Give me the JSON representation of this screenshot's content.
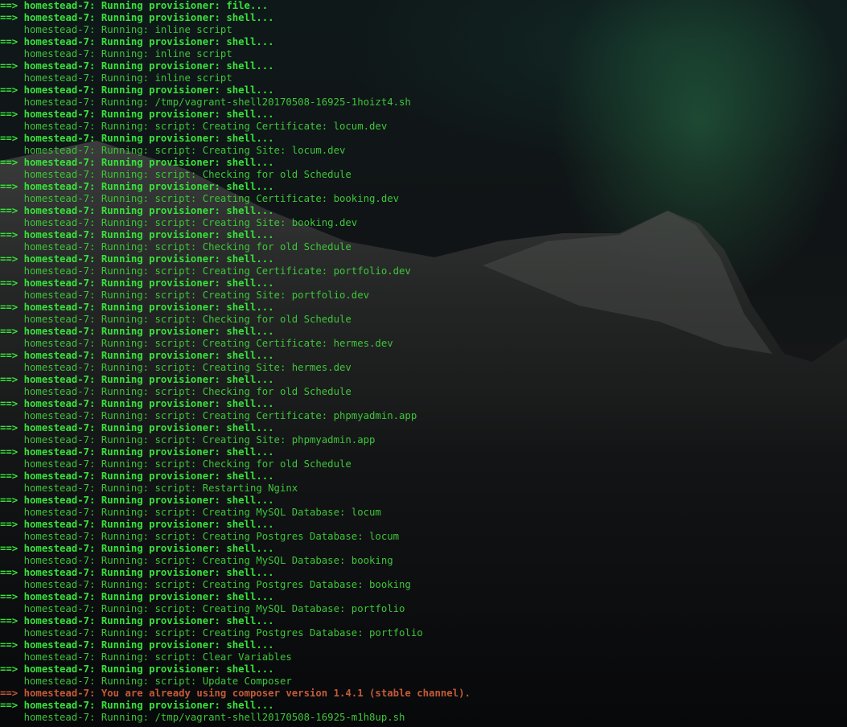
{
  "colors": {
    "header_green": "#38e23a",
    "detail_green": "#3ec63a",
    "warning_red": "#c45a36"
  },
  "terminal": {
    "lines": [
      {
        "kind": "header",
        "arrow": "==>",
        "text": " homestead-7: Running provisioner: file..."
      },
      {
        "kind": "header",
        "arrow": "==>",
        "text": " homestead-7: Running provisioner: shell..."
      },
      {
        "kind": "detail",
        "text": "    homestead-7: Running: inline script"
      },
      {
        "kind": "header",
        "arrow": "==>",
        "text": " homestead-7: Running provisioner: shell..."
      },
      {
        "kind": "detail",
        "text": "    homestead-7: Running: inline script"
      },
      {
        "kind": "header",
        "arrow": "==>",
        "text": " homestead-7: Running provisioner: shell..."
      },
      {
        "kind": "detail",
        "text": "    homestead-7: Running: inline script"
      },
      {
        "kind": "header",
        "arrow": "==>",
        "text": " homestead-7: Running provisioner: shell..."
      },
      {
        "kind": "detail",
        "text": "    homestead-7: Running: /tmp/vagrant-shell20170508-16925-1hoizt4.sh"
      },
      {
        "kind": "header",
        "arrow": "==>",
        "text": " homestead-7: Running provisioner: shell..."
      },
      {
        "kind": "detail",
        "text": "    homestead-7: Running: script: Creating Certificate: locum.dev"
      },
      {
        "kind": "header",
        "arrow": "==>",
        "text": " homestead-7: Running provisioner: shell..."
      },
      {
        "kind": "detail",
        "text": "    homestead-7: Running: script: Creating Site: locum.dev"
      },
      {
        "kind": "header",
        "arrow": "==>",
        "text": " homestead-7: Running provisioner: shell..."
      },
      {
        "kind": "detail",
        "text": "    homestead-7: Running: script: Checking for old Schedule"
      },
      {
        "kind": "header",
        "arrow": "==>",
        "text": " homestead-7: Running provisioner: shell..."
      },
      {
        "kind": "detail",
        "text": "    homestead-7: Running: script: Creating Certificate: booking.dev"
      },
      {
        "kind": "header",
        "arrow": "==>",
        "text": " homestead-7: Running provisioner: shell..."
      },
      {
        "kind": "detail",
        "text": "    homestead-7: Running: script: Creating Site: booking.dev"
      },
      {
        "kind": "header",
        "arrow": "==>",
        "text": " homestead-7: Running provisioner: shell..."
      },
      {
        "kind": "detail",
        "text": "    homestead-7: Running: script: Checking for old Schedule"
      },
      {
        "kind": "header",
        "arrow": "==>",
        "text": " homestead-7: Running provisioner: shell..."
      },
      {
        "kind": "detail",
        "text": "    homestead-7: Running: script: Creating Certificate: portfolio.dev"
      },
      {
        "kind": "header",
        "arrow": "==>",
        "text": " homestead-7: Running provisioner: shell..."
      },
      {
        "kind": "detail",
        "text": "    homestead-7: Running: script: Creating Site: portfolio.dev"
      },
      {
        "kind": "header",
        "arrow": "==>",
        "text": " homestead-7: Running provisioner: shell..."
      },
      {
        "kind": "detail",
        "text": "    homestead-7: Running: script: Checking for old Schedule"
      },
      {
        "kind": "header",
        "arrow": "==>",
        "text": " homestead-7: Running provisioner: shell..."
      },
      {
        "kind": "detail",
        "text": "    homestead-7: Running: script: Creating Certificate: hermes.dev"
      },
      {
        "kind": "header",
        "arrow": "==>",
        "text": " homestead-7: Running provisioner: shell..."
      },
      {
        "kind": "detail",
        "text": "    homestead-7: Running: script: Creating Site: hermes.dev"
      },
      {
        "kind": "header",
        "arrow": "==>",
        "text": " homestead-7: Running provisioner: shell..."
      },
      {
        "kind": "detail",
        "text": "    homestead-7: Running: script: Checking for old Schedule"
      },
      {
        "kind": "header",
        "arrow": "==>",
        "text": " homestead-7: Running provisioner: shell..."
      },
      {
        "kind": "detail",
        "text": "    homestead-7: Running: script: Creating Certificate: phpmyadmin.app"
      },
      {
        "kind": "header",
        "arrow": "==>",
        "text": " homestead-7: Running provisioner: shell..."
      },
      {
        "kind": "detail",
        "text": "    homestead-7: Running: script: Creating Site: phpmyadmin.app"
      },
      {
        "kind": "header",
        "arrow": "==>",
        "text": " homestead-7: Running provisioner: shell..."
      },
      {
        "kind": "detail",
        "text": "    homestead-7: Running: script: Checking for old Schedule"
      },
      {
        "kind": "header",
        "arrow": "==>",
        "text": " homestead-7: Running provisioner: shell..."
      },
      {
        "kind": "detail",
        "text": "    homestead-7: Running: script: Restarting Nginx"
      },
      {
        "kind": "header",
        "arrow": "==>",
        "text": " homestead-7: Running provisioner: shell..."
      },
      {
        "kind": "detail",
        "text": "    homestead-7: Running: script: Creating MySQL Database: locum"
      },
      {
        "kind": "header",
        "arrow": "==>",
        "text": " homestead-7: Running provisioner: shell..."
      },
      {
        "kind": "detail",
        "text": "    homestead-7: Running: script: Creating Postgres Database: locum"
      },
      {
        "kind": "header",
        "arrow": "==>",
        "text": " homestead-7: Running provisioner: shell..."
      },
      {
        "kind": "detail",
        "text": "    homestead-7: Running: script: Creating MySQL Database: booking"
      },
      {
        "kind": "header",
        "arrow": "==>",
        "text": " homestead-7: Running provisioner: shell..."
      },
      {
        "kind": "detail",
        "text": "    homestead-7: Running: script: Creating Postgres Database: booking"
      },
      {
        "kind": "header",
        "arrow": "==>",
        "text": " homestead-7: Running provisioner: shell..."
      },
      {
        "kind": "detail",
        "text": "    homestead-7: Running: script: Creating MySQL Database: portfolio"
      },
      {
        "kind": "header",
        "arrow": "==>",
        "text": " homestead-7: Running provisioner: shell..."
      },
      {
        "kind": "detail",
        "text": "    homestead-7: Running: script: Creating Postgres Database: portfolio"
      },
      {
        "kind": "header",
        "arrow": "==>",
        "text": " homestead-7: Running provisioner: shell..."
      },
      {
        "kind": "detail",
        "text": "    homestead-7: Running: script: Clear Variables"
      },
      {
        "kind": "header",
        "arrow": "==>",
        "text": " homestead-7: Running provisioner: shell..."
      },
      {
        "kind": "detail",
        "text": "    homestead-7: Running: script: Update Composer"
      },
      {
        "kind": "error",
        "arrow": "==>",
        "text": " homestead-7: You are already using composer version 1.4.1 (stable channel)."
      },
      {
        "kind": "header",
        "arrow": "==>",
        "text": " homestead-7: Running provisioner: shell..."
      },
      {
        "kind": "detail",
        "text": "    homestead-7: Running: /tmp/vagrant-shell20170508-16925-m1h8up.sh"
      }
    ]
  }
}
